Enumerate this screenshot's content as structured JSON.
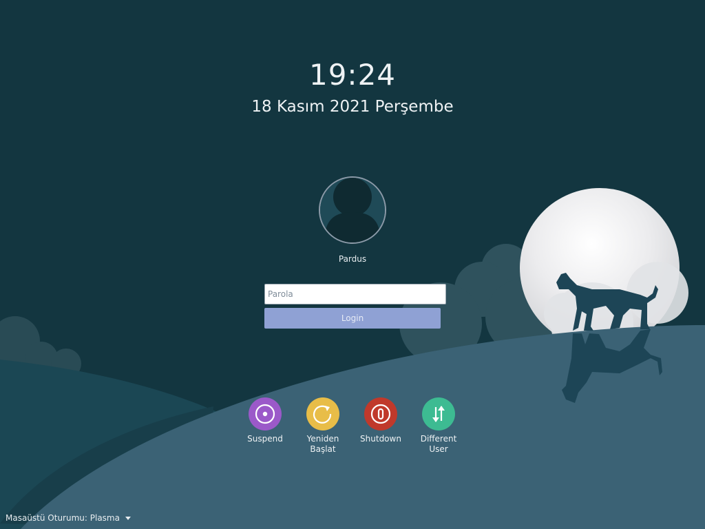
{
  "clock": {
    "time": "19:24",
    "date": "18 Kasım 2021 Perşembe"
  },
  "user": {
    "name": "Pardus"
  },
  "login": {
    "password_placeholder": "Parola",
    "button_label": "Login"
  },
  "actions": [
    {
      "label_line1": "Suspend",
      "label_line2": "",
      "color": "#9b59c9",
      "icon": "suspend-icon"
    },
    {
      "label_line1": "Yeniden",
      "label_line2": "Başlat",
      "color": "#e8bd48",
      "icon": "restart-icon"
    },
    {
      "label_line1": "Shutdown",
      "label_line2": "",
      "color": "#c0392b",
      "icon": "shutdown-icon"
    },
    {
      "label_line1": "Different",
      "label_line2": "User",
      "color": "#3dbb92",
      "icon": "switch-user-icon"
    }
  ],
  "session": {
    "label": "Masaüstü Oturumu: Plasma"
  },
  "colors": {
    "sky": "#133640",
    "hill": "#3b6275",
    "moon": "#e9eaec",
    "cloud": "#2c4e59"
  }
}
